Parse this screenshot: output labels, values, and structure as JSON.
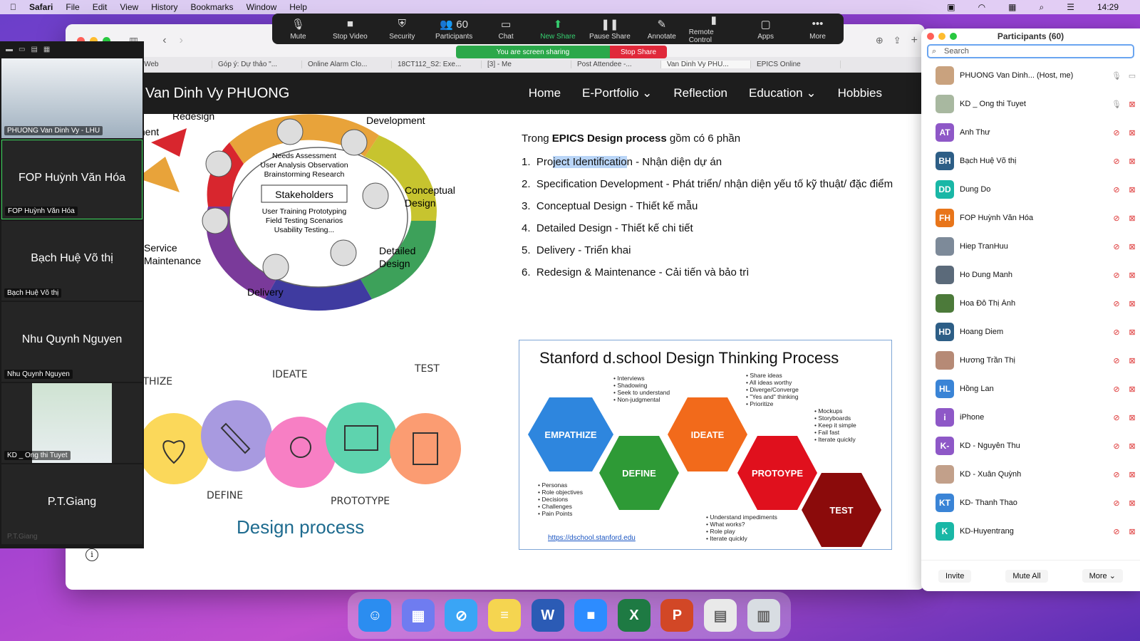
{
  "menubar": {
    "app": "Safari",
    "items": [
      "File",
      "Edit",
      "View",
      "History",
      "Bookmarks",
      "Window",
      "Help"
    ],
    "clock": "14:29"
  },
  "browser": {
    "tabs": [
      "Zalo Web",
      "Góp ý: Dự thảo \"...",
      "Online Alarm Clo...",
      "18CT112_S2: Exe...",
      "[3] - Me",
      "Post Attendee -...",
      "Van Dinh Vy PHU...",
      "EPICS Online"
    ],
    "active_tab": 6
  },
  "site": {
    "title": "Van Dinh Vy PHUONG",
    "nav": [
      {
        "label": "Home"
      },
      {
        "label": "E-Portfolio",
        "dropdown": true
      },
      {
        "label": "Reflection"
      },
      {
        "label": "Education",
        "dropdown": true
      },
      {
        "label": "Hobbies"
      }
    ]
  },
  "slide": {
    "ring_labels": {
      "redesign": "Redesign",
      "ment": "ment",
      "development": "Development",
      "conceptual": "Conceptual\nDesign",
      "detailed": "Detailed\nDesign",
      "delivery": "Delivery",
      "service": "Service\nMaintenance",
      "stakeholders": "Stakeholders",
      "inner_top": "Needs Assessment\nUser Analysis  Observation\nBrainstorming   Research",
      "inner_bottom": "User Training   Prototyping\nField Testing   Scenarios\nUsability Testing..."
    },
    "intro_prefix": "Trong ",
    "intro_bold": "EPICS Design process",
    "intro_suffix": " gồm có 6 phần",
    "steps": [
      {
        "num": "1.",
        "pre": "Pro",
        "hl": "ject Identificatio",
        "post": "n - Nhận diện dự án"
      },
      {
        "num": "2.",
        "text": "Specification Development - Phát triển/ nhận diện yếu tố kỹ thuật/ đặc điểm"
      },
      {
        "num": "3.",
        "text": "Conceptual Design - Thiết kế mẫu"
      },
      {
        "num": "4.",
        "text": "Detailed Design - Thiết kế chi tiết"
      },
      {
        "num": "5.",
        "text": "Delivery - Triển khai"
      },
      {
        "num": "6.",
        "text": "Redesign & Maintenance  - Cải tiến và bảo trì"
      }
    ],
    "dt_labels": {
      "empathize": "ATHIZE",
      "ideate": "IDEATE",
      "test": "TEST",
      "define": "DEFINE",
      "prototype": "PROTOTYPE"
    },
    "design_process": "Design process",
    "stanford": {
      "title": "Stanford d.school Design Thinking Process",
      "hex": [
        "EMPATHIZE",
        "DEFINE",
        "IDEATE",
        "PROTOYPE",
        "TEST"
      ],
      "notes_empathize": [
        "• Interviews",
        "• Shadowing",
        "• Seek to understand",
        "• Non-judgmental"
      ],
      "notes_ideate": [
        "• Share ideas",
        "• All ideas worthy",
        "• Diverge/Converge",
        "• \"Yes and\" thinking",
        "• Prioritize"
      ],
      "notes_proto": [
        "• Mockups",
        "• Storyboards",
        "• Keep it simple",
        "• Fail fast",
        "• Iterate quickly"
      ],
      "notes_define": [
        "• Personas",
        "• Role objectives",
        "• Decisions",
        "• Challenges",
        "• Pain Points"
      ],
      "notes_test": [
        "• Understand impediments",
        "• What works?",
        "• Role play",
        "• Iterate quickly"
      ],
      "link": "https://dschool.stanford.edu"
    }
  },
  "zoom": {
    "buttons": [
      {
        "label": "Mute",
        "icon": "🎙"
      },
      {
        "label": "Stop Video",
        "icon": "■"
      },
      {
        "label": "Security",
        "icon": "⛨"
      },
      {
        "label": "Participants",
        "icon": "👥 60"
      },
      {
        "label": "Chat",
        "icon": "▭"
      },
      {
        "label": "New Share",
        "icon": "⬆"
      },
      {
        "label": "Pause Share",
        "icon": "❚❚"
      },
      {
        "label": "Annotate",
        "icon": "✎"
      },
      {
        "label": "Remote Control",
        "icon": "▮"
      },
      {
        "label": "Apps",
        "icon": "▢"
      },
      {
        "label": "More",
        "icon": "•••"
      }
    ],
    "sharing_msg": "You are screen sharing",
    "stop_share": "Stop Share",
    "tiles": [
      {
        "name": "PHUONG Van Dinh Vy - LHU",
        "big": ""
      },
      {
        "name": "FOP Huỳnh Văn Hóa",
        "big": "FOP Huỳnh Văn Hóa"
      },
      {
        "name": "Bạch Huệ Võ thị",
        "big": "Bạch Huệ Võ thị"
      },
      {
        "name": "Nhu Quynh Nguyen",
        "big": "Nhu Quynh Nguyen"
      },
      {
        "name": "KD _ Ong thi Tuyet",
        "big": ""
      },
      {
        "name": "P.T.Giang",
        "big": "P.T.Giang"
      }
    ]
  },
  "participants": {
    "title": "Participants (60)",
    "search_placeholder": "Search",
    "list": [
      {
        "initials": "",
        "name": "PHUONG Van Dinh... (Host, me)",
        "color": "#c9a27e"
      },
      {
        "initials": "",
        "name": "KD _ Ong thi Tuyet",
        "color": "#a8b8a0"
      },
      {
        "initials": "AT",
        "name": "Anh Thư",
        "color": "#8e58c7"
      },
      {
        "initials": "BH",
        "name": "Bạch Huệ Võ thị",
        "color": "#2d5e86"
      },
      {
        "initials": "DD",
        "name": "Dung Do",
        "color": "#19b7a6"
      },
      {
        "initials": "FH",
        "name": "FOP Huỳnh Văn Hóa",
        "color": "#e8751a"
      },
      {
        "initials": "",
        "name": "Hiep TranHuu",
        "color": "#7d8a99"
      },
      {
        "initials": "",
        "name": "Ho Dung Manh",
        "color": "#5b6a7a"
      },
      {
        "initials": "",
        "name": "Hoa Đỗ Thị Ánh",
        "color": "#4c7a3a"
      },
      {
        "initials": "HD",
        "name": "Hoang Diem",
        "color": "#2d5e86"
      },
      {
        "initials": "",
        "name": "Hương Trần Thị",
        "color": "#b68a76"
      },
      {
        "initials": "HL",
        "name": "Hồng Lan",
        "color": "#3a84d6"
      },
      {
        "initials": "i",
        "name": "iPhone",
        "color": "#8e58c7"
      },
      {
        "initials": "K-",
        "name": "KD - Nguyễn Thu",
        "color": "#8e58c7"
      },
      {
        "initials": "",
        "name": "KD - Xuân Quỳnh",
        "color": "#c2a08a"
      },
      {
        "initials": "KT",
        "name": "KD- Thanh Thao",
        "color": "#3a84d6"
      },
      {
        "initials": "K",
        "name": "KD-Huyentrang",
        "color": "#19b7a6"
      }
    ],
    "invite": "Invite",
    "mute_all": "Mute All",
    "more": "More"
  }
}
